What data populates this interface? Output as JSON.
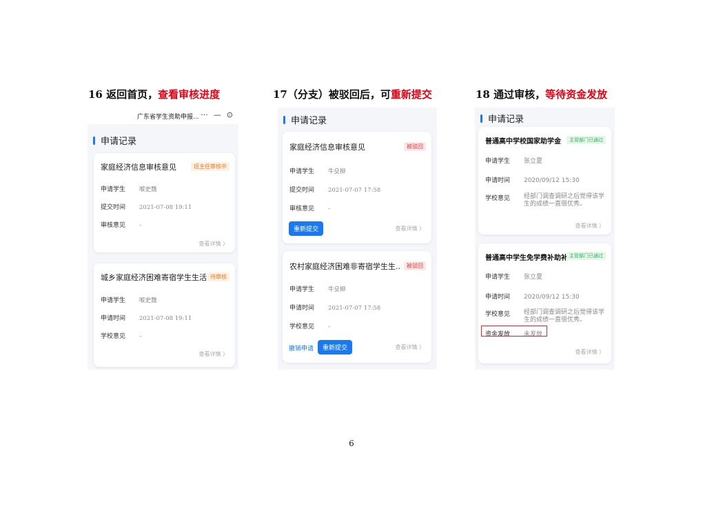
{
  "steps": [
    {
      "title_prefix": "16 返回首页，",
      "title_highlight": "查看审核进度",
      "app_title": "广东省学生资助申报...",
      "more_icon": "···",
      "min_icon": "—",
      "close_icon": "⊙",
      "section": "申请记录",
      "cards": [
        {
          "title": "家庭经济信息审核意见",
          "badge": "班主任审核中",
          "rows": [
            {
              "k": "申请学生",
              "v": "喉史魏"
            },
            {
              "k": "提交时间",
              "v": "2021-07-08 19:11"
            },
            {
              "k": "审核意见",
              "v": "-"
            }
          ],
          "detail": "查看详情 〉"
        },
        {
          "title": "城乡家庭经济困难寄宿学生生活...",
          "badge": "待审核",
          "rows": [
            {
              "k": "申请学生",
              "v": "喉史魏"
            },
            {
              "k": "申请时间",
              "v": "2021-07-08 19:11"
            },
            {
              "k": "学校意见",
              "v": "-"
            }
          ],
          "detail": "查看详情 〉"
        }
      ]
    },
    {
      "title_prefix": "17（分支）被驳回后，可",
      "title_highlight": "重新提交",
      "section": "申请记录",
      "cards": [
        {
          "title": "家庭经济信息审核意见",
          "badge": "被驳回",
          "rows": [
            {
              "k": "申请学生",
              "v": "牛殳柳"
            },
            {
              "k": "提交时间",
              "v": "2021-07-07 17:58"
            },
            {
              "k": "审核意见",
              "v": "-"
            }
          ],
          "button": "重新提交",
          "detail": "查看详情 〉"
        },
        {
          "title": "农村家庭经济困难非寄宿学生生...",
          "badge": "被驳回",
          "rows": [
            {
              "k": "申请学生",
              "v": "牛殳柳"
            },
            {
              "k": "申请时间",
              "v": "2021-07-07 17:58"
            },
            {
              "k": "学校意见",
              "v": "-"
            }
          ],
          "link": "撤销申请",
          "button": "重新提交",
          "detail": "查看详情 〉"
        }
      ]
    },
    {
      "title_prefix": "18 通过审核，",
      "title_highlight": "等待资金发放",
      "section": "申请记录",
      "cards": [
        {
          "title": "普通高中学校国家助学金",
          "badge": "主管部门已通过",
          "rows": [
            {
              "k": "申请学生",
              "v": "张立夏"
            },
            {
              "k": "申请时间",
              "v": "2020/09/12  15:30"
            },
            {
              "k": "学校意见",
              "v": "经部门调查调研之后觉得该学生的成绩一直很优秀。"
            }
          ],
          "detail": "查看详情 〉"
        },
        {
          "title": "普通高中学生免学费补助补!",
          "badge": "主管部门已通过",
          "rows": [
            {
              "k": "申请学生",
              "v": "张立夏"
            },
            {
              "k": "申请时间",
              "v": "2020/09/12  15:30"
            },
            {
              "k": "学校意见",
              "v": "经部门调查调研之后觉得该学生的成绩一直很优秀。"
            },
            {
              "k": "资金发放",
              "v": "未发放"
            }
          ],
          "detail": "查看详情 〉"
        }
      ]
    }
  ],
  "page_number": "6"
}
